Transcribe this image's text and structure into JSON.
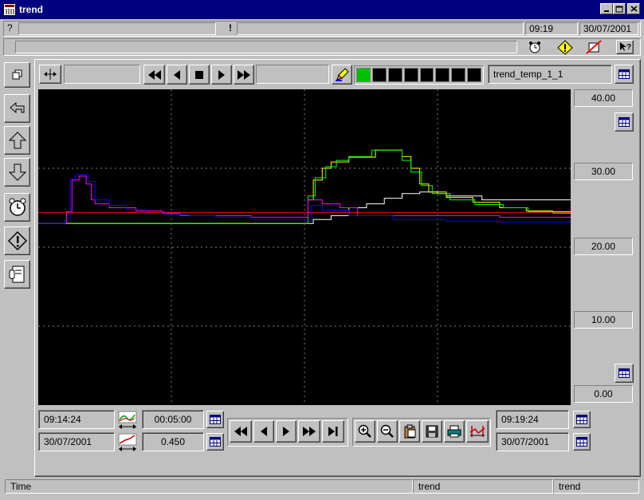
{
  "window": {
    "title": "trend"
  },
  "info_bar": {
    "help": "?",
    "alert": "!",
    "time": "09:19",
    "date": "30/07/2001"
  },
  "toolbar": {
    "trend_name": "trend_temp_1_1",
    "led_count": 8,
    "led_active": 1
  },
  "scale": {
    "max": "40.00",
    "v30": "30.00",
    "v20": "20.00",
    "v10": "10.00",
    "min": "0.00"
  },
  "bottom": {
    "start_time": "09:14:24",
    "start_date": "30/07/2001",
    "span": "00:05:00",
    "factor": "0.450",
    "end_time": "09:19:24",
    "end_date": "30/07/2001"
  },
  "status": {
    "left": "Time",
    "mid": "trend",
    "right": "trend"
  },
  "chart_data": {
    "type": "line",
    "ylim": [
      0,
      40
    ],
    "xlim": [
      "09:14:24",
      "09:19:24"
    ],
    "grid": true,
    "series": [
      {
        "color": "#ff0000",
        "x_sec": [
          0,
          300
        ],
        "y": [
          24.4,
          24.4
        ]
      },
      {
        "color": "#ffffff",
        "x_sec": [
          0,
          150,
          155,
          165,
          175,
          185,
          195,
          205,
          215,
          225,
          230,
          250,
          270,
          300
        ],
        "y": [
          23.0,
          23.0,
          23.5,
          24.0,
          25.0,
          25.5,
          26.2,
          26.8,
          27.0,
          26.8,
          26.5,
          26.0,
          26.0,
          26.0
        ]
      },
      {
        "color": "#ffff00",
        "x_sec": [
          0,
          150,
          152,
          155,
          160,
          165,
          175,
          190,
          200,
          205,
          210,
          215,
          220,
          230,
          245,
          260,
          275,
          290,
          300
        ],
        "y": [
          23.0,
          23.0,
          26.0,
          28.5,
          30.0,
          30.8,
          31.4,
          32.3,
          32.3,
          31.5,
          30.0,
          28.0,
          27.0,
          26.3,
          25.7,
          25.0,
          24.6,
          24.5,
          24.5
        ]
      },
      {
        "color": "#00ff00",
        "x_sec": [
          0,
          150,
          152,
          156,
          162,
          168,
          175,
          188,
          198,
          205,
          210,
          216,
          222,
          232,
          246,
          262,
          276,
          290,
          300
        ],
        "y": [
          23.0,
          23.0,
          26.5,
          28.8,
          30.2,
          31.0,
          31.5,
          32.3,
          32.3,
          31.0,
          29.5,
          27.8,
          26.8,
          26.0,
          25.4,
          25.0,
          24.5,
          24.3,
          24.3
        ]
      },
      {
        "color": "#ff00ff",
        "x_sec": [
          0,
          7,
          16,
          19,
          23,
          27,
          30,
          32,
          40,
          55,
          70,
          80,
          100,
          120,
          140,
          150,
          152,
          160,
          170,
          180,
          190,
          220,
          260,
          300
        ],
        "y": [
          23.0,
          23.0,
          24.5,
          28.5,
          29.0,
          28.0,
          26.0,
          25.5,
          25.0,
          24.6,
          24.3,
          24.0,
          24.0,
          23.8,
          23.8,
          23.8,
          26.0,
          25.5,
          25.0,
          24.0,
          24.0,
          24.0,
          23.8,
          23.8
        ]
      },
      {
        "color": "#0000ff",
        "x_sec": [
          0,
          8,
          15,
          18,
          21,
          24,
          28,
          32,
          40,
          50,
          60,
          72,
          85,
          100,
          120,
          150,
          154,
          160,
          175,
          200,
          230,
          260,
          300
        ],
        "y": [
          23.0,
          23.0,
          23.5,
          28.6,
          29.2,
          29.2,
          28.3,
          26.0,
          25.3,
          24.8,
          24.5,
          24.2,
          24.0,
          23.8,
          23.5,
          23.3,
          25.3,
          24.7,
          24.0,
          23.5,
          23.3,
          23.2,
          23.2
        ]
      }
    ]
  }
}
